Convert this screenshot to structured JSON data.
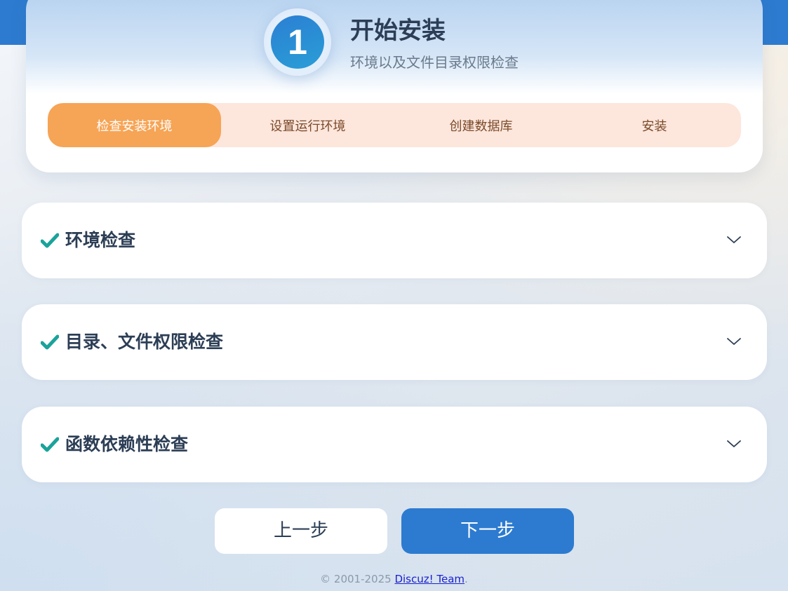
{
  "header": {
    "step_number": "1",
    "title": "开始安装",
    "subtitle": "环境以及文件目录权限检查"
  },
  "steps": [
    {
      "label": "检查安装环境",
      "active": true
    },
    {
      "label": "设置运行环境",
      "active": false
    },
    {
      "label": "创建数据库",
      "active": false
    },
    {
      "label": "安装",
      "active": false
    }
  ],
  "sections": [
    {
      "title": "环境检查",
      "status": "check-icon",
      "toggle": "chevron-down-icon"
    },
    {
      "title": "目录、文件权限检查",
      "status": "check-icon",
      "toggle": "chevron-down-icon"
    },
    {
      "title": "函数依赖性检查",
      "status": "check-icon",
      "toggle": "chevron-down-icon"
    }
  ],
  "buttons": {
    "prev_label": "上一步",
    "next_label": "下一步"
  },
  "footer": {
    "copyright": "© 2001-2025 ",
    "link_text": "Discuz! Team",
    "suffix": "."
  },
  "colors": {
    "brand_blue": "#2d7bd0",
    "active_step": "#f6a455",
    "steps_bg": "#fde6dc",
    "check_teal": "#1aa39a",
    "title_dark": "#2c3e55"
  }
}
